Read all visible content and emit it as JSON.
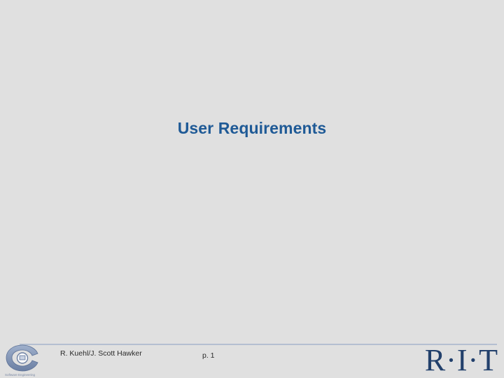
{
  "slide": {
    "title": "User Requirements",
    "footer": {
      "authors": "R. Kuehl/J. Scott Hawker",
      "page": "p. 1",
      "logo_text": "R·I·T",
      "left_logo_caption": "Software Engineering"
    }
  },
  "colors": {
    "background": "#e0e0e0",
    "title": "#1f5a96",
    "rule": "#b4bfd1",
    "logo_blue": "#22406c"
  },
  "icons": {
    "left_logo": "software-engineering-logo",
    "right_logo": "rit-logo"
  }
}
